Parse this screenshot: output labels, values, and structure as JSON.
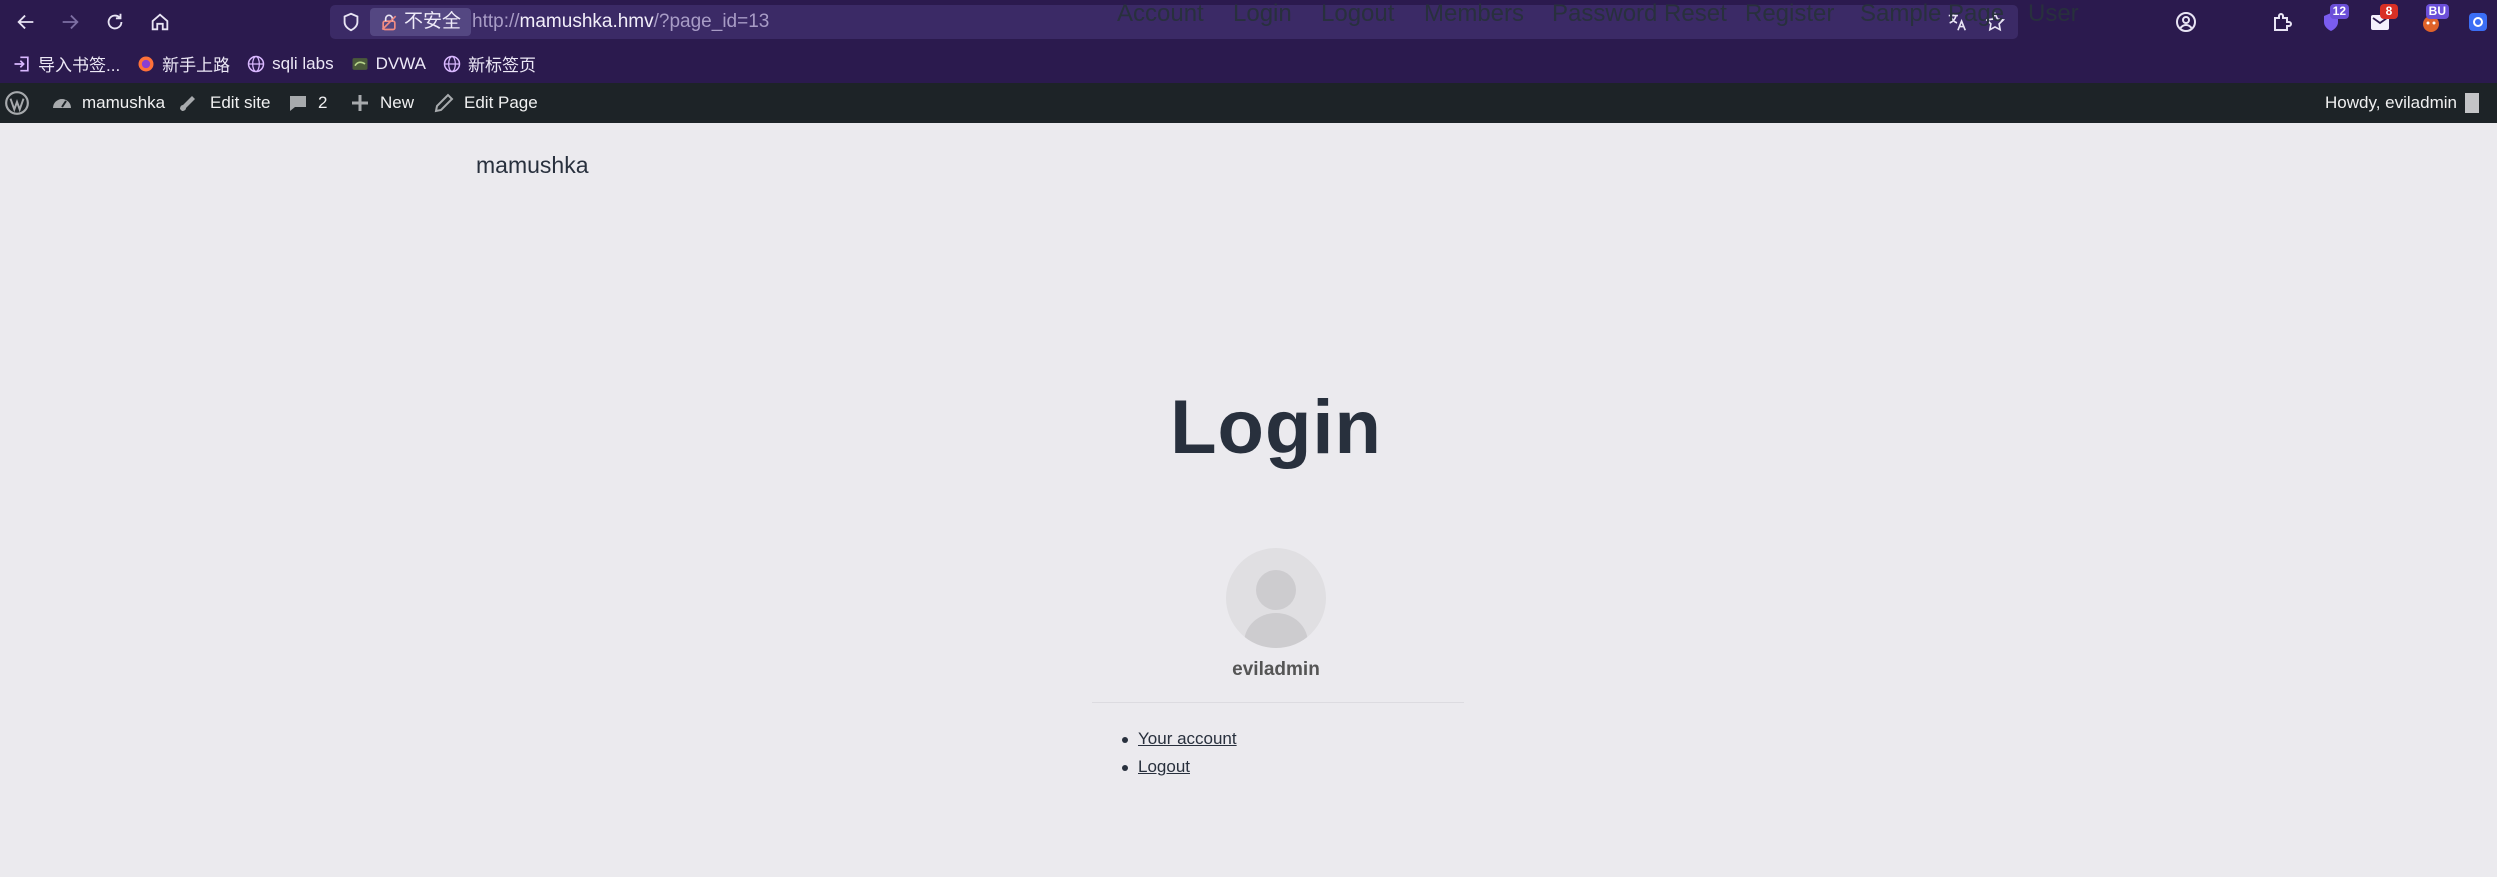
{
  "browser": {
    "url_prefix": "http://",
    "url_host": "mamushka.hmv",
    "url_path": "/?page_id=13",
    "insecure_label": "不安全",
    "extensions": [
      {
        "name": "account-icon"
      },
      {
        "name": "extensions-icon"
      },
      {
        "name": "ext-shield-icon",
        "badge": "12",
        "badge_color": "#6b4fd8"
      },
      {
        "name": "ext-mail-icon",
        "badge": "8",
        "badge_color": "#d93025"
      },
      {
        "name": "ext-bu-icon",
        "badge": "BU",
        "badge_color": "#6b4fd8"
      },
      {
        "name": "ext-blue-icon"
      }
    ]
  },
  "bookmarks": [
    {
      "label": "导入书签...",
      "icon": "import-icon"
    },
    {
      "label": "新手上路",
      "icon": "firefox-icon"
    },
    {
      "label": "sqli labs",
      "icon": "globe-icon"
    },
    {
      "label": "DVWA",
      "icon": "dvwa-icon"
    },
    {
      "label": "新标签页",
      "icon": "globe-icon"
    }
  ],
  "adminbar": {
    "site_name": "mamushka",
    "edit_site": "Edit site",
    "comments_count": "2",
    "new_label": "New",
    "edit_page": "Edit Page",
    "howdy": "Howdy, eviladmin"
  },
  "site": {
    "title": "mamushka",
    "nav": [
      "Account",
      "Login",
      "Logout",
      "Members",
      "Password Reset",
      "Register",
      "Sample Page",
      "User"
    ]
  },
  "content": {
    "page_title": "Login",
    "username": "eviladmin",
    "links": [
      "Your account",
      "Logout"
    ]
  },
  "colors": {
    "browser_chrome": "#2b1a4e",
    "admin_bar": "#1d2327",
    "page_background": "#ebeaee",
    "text": "#28303d"
  }
}
